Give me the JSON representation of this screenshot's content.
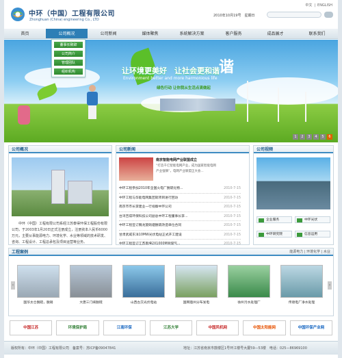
{
  "header": {
    "title_cn": "中环（中国）工程有限公司",
    "title_en": "Zhonghuan (China) engineering Co., LTD",
    "lang_cn": "中文",
    "lang_sep": "|",
    "lang_en": "ENGLISH",
    "date": "2010年10月19号　星期日"
  },
  "nav": [
    "首页",
    "公司概况",
    "公司新闻",
    "媒体聚焦",
    "系统解决方案",
    "客户服务",
    "成品展才",
    "联系我们"
  ],
  "dropdown": [
    "董事长致辞",
    "公司简介",
    "管理团队",
    "组织机构"
  ],
  "hero": {
    "slogan": "让环境更美好　让社会更和谐",
    "slogan_en": "Environment better and more harmonious life",
    "sub": "绿色行动 让你我从生活点滴做起",
    "big": "谐",
    "pages": [
      "1",
      "2",
      "3",
      "4",
      "5",
      "6"
    ]
  },
  "about": {
    "title": "公司概况",
    "text": "中环（中国）工程有限公司系经江苏泰得环保工程股份有限公司，于2003年1月20日正式注册成立，注册资本人民币6000万元，主要从事能源电力、环境化学、水业等领域的技术研发、咨询、工程设计、工程总承包及项目运营等业务。"
  },
  "news": {
    "title": "公司新闻",
    "top_title": "南京智能电网产业联盟成立",
    "top_desc": "“打造千亿智能电网产业，成为国家智能电网产业强镇”，电网产业联盟正大会...",
    "items": [
      {
        "t": "中环工程参加2010年全国火电厂脱硫化物...",
        "d": "2010-7-15"
      },
      {
        "t": "中环工程与华能电网集团就项目进行回访",
        "d": "2010-7-15"
      },
      {
        "t": "南京市市长李建业一行视察中环公司",
        "d": "2010-7-15"
      },
      {
        "t": "台湾吉得环保科技公司副总中环工程董事长李...",
        "d": "2010-7-15"
      },
      {
        "t": "中环工程签订魏龙旋硝烟脱硫改造单位合同",
        "d": "2010-7-15"
      },
      {
        "t": "甘肃武威东洋10MW光伏电站正式开工建设",
        "d": "2010-7-15"
      },
      {
        "t": "中环工程签订江苏南坤2X1000MW煤气...",
        "d": "2010-7-15"
      }
    ]
  },
  "video": {
    "title": "公司视频",
    "buttons": [
      "企业服务",
      "中环光伏",
      "中环研究院",
      "信息运用"
    ]
  },
  "cases": {
    "title": "工程案例",
    "filters": "能源电力 | 环境化学 | 水业",
    "items": [
      "国华太仓脱硫，脱硝",
      "大唐三门峡脱硫",
      "山西古交光伏电站",
      "国网宿州分布发电",
      "徐州污水处理厂",
      "传德电厂净水处理"
    ]
  },
  "partners": [
    "中国江苏",
    "环境保护局",
    "江南环保",
    "江苏大学",
    "中国风机网",
    "中国太阳能网",
    "中国环保产业网"
  ],
  "footer": {
    "left": "版权所有：中环（中国）工程有限公司　备案号：苏ICP备09047841",
    "right": "地址：江苏省南京市鼓楼区1号环江楼号大厦59—53楼　电话：025—86969100"
  },
  "colors": {
    "nav_active": "#2d7fb6",
    "accent_green": "#3b9a22",
    "title_blue": "#1c5a8a"
  }
}
